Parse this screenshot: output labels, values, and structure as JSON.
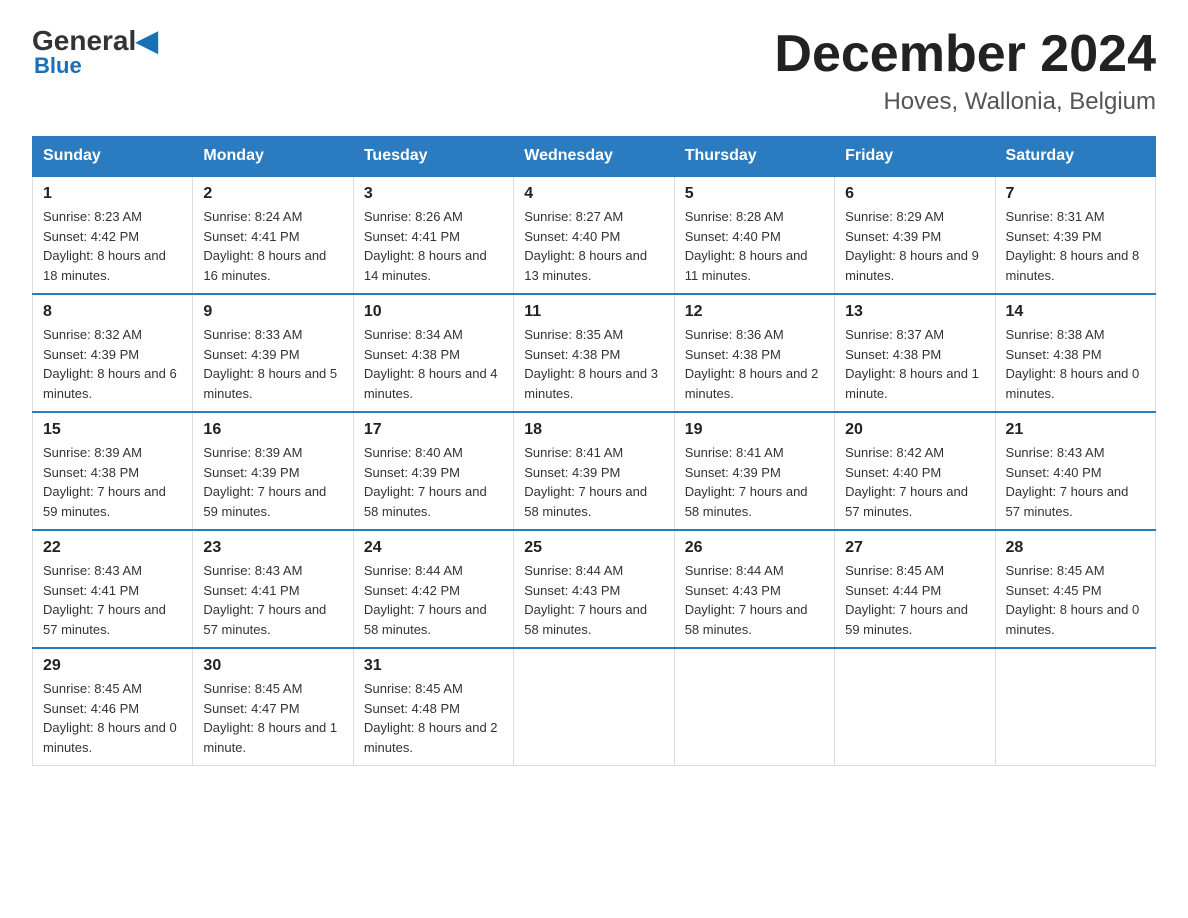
{
  "header": {
    "logo": {
      "general": "General",
      "blue": "Blue"
    },
    "title": "December 2024",
    "location": "Hoves, Wallonia, Belgium"
  },
  "days_of_week": [
    "Sunday",
    "Monday",
    "Tuesday",
    "Wednesday",
    "Thursday",
    "Friday",
    "Saturday"
  ],
  "weeks": [
    [
      {
        "day": "1",
        "sunrise": "8:23 AM",
        "sunset": "4:42 PM",
        "daylight": "8 hours and 18 minutes."
      },
      {
        "day": "2",
        "sunrise": "8:24 AM",
        "sunset": "4:41 PM",
        "daylight": "8 hours and 16 minutes."
      },
      {
        "day": "3",
        "sunrise": "8:26 AM",
        "sunset": "4:41 PM",
        "daylight": "8 hours and 14 minutes."
      },
      {
        "day": "4",
        "sunrise": "8:27 AM",
        "sunset": "4:40 PM",
        "daylight": "8 hours and 13 minutes."
      },
      {
        "day": "5",
        "sunrise": "8:28 AM",
        "sunset": "4:40 PM",
        "daylight": "8 hours and 11 minutes."
      },
      {
        "day": "6",
        "sunrise": "8:29 AM",
        "sunset": "4:39 PM",
        "daylight": "8 hours and 9 minutes."
      },
      {
        "day": "7",
        "sunrise": "8:31 AM",
        "sunset": "4:39 PM",
        "daylight": "8 hours and 8 minutes."
      }
    ],
    [
      {
        "day": "8",
        "sunrise": "8:32 AM",
        "sunset": "4:39 PM",
        "daylight": "8 hours and 6 minutes."
      },
      {
        "day": "9",
        "sunrise": "8:33 AM",
        "sunset": "4:39 PM",
        "daylight": "8 hours and 5 minutes."
      },
      {
        "day": "10",
        "sunrise": "8:34 AM",
        "sunset": "4:38 PM",
        "daylight": "8 hours and 4 minutes."
      },
      {
        "day": "11",
        "sunrise": "8:35 AM",
        "sunset": "4:38 PM",
        "daylight": "8 hours and 3 minutes."
      },
      {
        "day": "12",
        "sunrise": "8:36 AM",
        "sunset": "4:38 PM",
        "daylight": "8 hours and 2 minutes."
      },
      {
        "day": "13",
        "sunrise": "8:37 AM",
        "sunset": "4:38 PM",
        "daylight": "8 hours and 1 minute."
      },
      {
        "day": "14",
        "sunrise": "8:38 AM",
        "sunset": "4:38 PM",
        "daylight": "8 hours and 0 minutes."
      }
    ],
    [
      {
        "day": "15",
        "sunrise": "8:39 AM",
        "sunset": "4:38 PM",
        "daylight": "7 hours and 59 minutes."
      },
      {
        "day": "16",
        "sunrise": "8:39 AM",
        "sunset": "4:39 PM",
        "daylight": "7 hours and 59 minutes."
      },
      {
        "day": "17",
        "sunrise": "8:40 AM",
        "sunset": "4:39 PM",
        "daylight": "7 hours and 58 minutes."
      },
      {
        "day": "18",
        "sunrise": "8:41 AM",
        "sunset": "4:39 PM",
        "daylight": "7 hours and 58 minutes."
      },
      {
        "day": "19",
        "sunrise": "8:41 AM",
        "sunset": "4:39 PM",
        "daylight": "7 hours and 58 minutes."
      },
      {
        "day": "20",
        "sunrise": "8:42 AM",
        "sunset": "4:40 PM",
        "daylight": "7 hours and 57 minutes."
      },
      {
        "day": "21",
        "sunrise": "8:43 AM",
        "sunset": "4:40 PM",
        "daylight": "7 hours and 57 minutes."
      }
    ],
    [
      {
        "day": "22",
        "sunrise": "8:43 AM",
        "sunset": "4:41 PM",
        "daylight": "7 hours and 57 minutes."
      },
      {
        "day": "23",
        "sunrise": "8:43 AM",
        "sunset": "4:41 PM",
        "daylight": "7 hours and 57 minutes."
      },
      {
        "day": "24",
        "sunrise": "8:44 AM",
        "sunset": "4:42 PM",
        "daylight": "7 hours and 58 minutes."
      },
      {
        "day": "25",
        "sunrise": "8:44 AM",
        "sunset": "4:43 PM",
        "daylight": "7 hours and 58 minutes."
      },
      {
        "day": "26",
        "sunrise": "8:44 AM",
        "sunset": "4:43 PM",
        "daylight": "7 hours and 58 minutes."
      },
      {
        "day": "27",
        "sunrise": "8:45 AM",
        "sunset": "4:44 PM",
        "daylight": "7 hours and 59 minutes."
      },
      {
        "day": "28",
        "sunrise": "8:45 AM",
        "sunset": "4:45 PM",
        "daylight": "8 hours and 0 minutes."
      }
    ],
    [
      {
        "day": "29",
        "sunrise": "8:45 AM",
        "sunset": "4:46 PM",
        "daylight": "8 hours and 0 minutes."
      },
      {
        "day": "30",
        "sunrise": "8:45 AM",
        "sunset": "4:47 PM",
        "daylight": "8 hours and 1 minute."
      },
      {
        "day": "31",
        "sunrise": "8:45 AM",
        "sunset": "4:48 PM",
        "daylight": "8 hours and 2 minutes."
      },
      null,
      null,
      null,
      null
    ]
  ]
}
